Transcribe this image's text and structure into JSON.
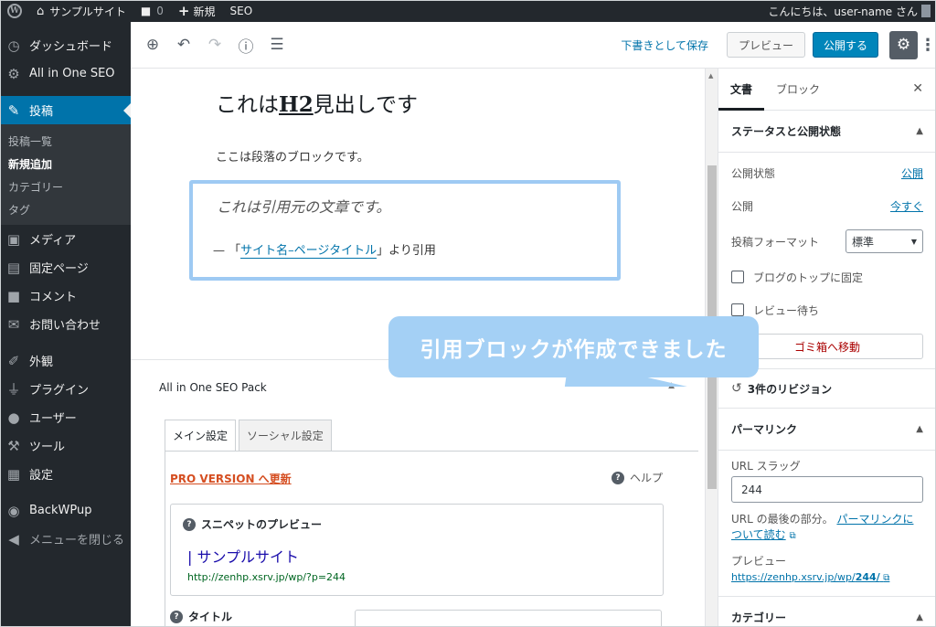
{
  "adminbar": {
    "site_name": "サンプルサイト",
    "comments_count": "0",
    "new_label": "新規",
    "seo_label": "SEO",
    "greeting": "こんにちは、user-name さん"
  },
  "sidebar": {
    "items": [
      {
        "label": "ダッシュボード",
        "icon": "dashboard-icon"
      },
      {
        "label": "All in One SEO",
        "icon": "gear-icon"
      },
      {
        "label": "投稿",
        "icon": "pin-icon"
      }
    ],
    "submenu": [
      {
        "label": "投稿一覧"
      },
      {
        "label": "新規追加"
      },
      {
        "label": "カテゴリー"
      },
      {
        "label": "タグ"
      }
    ],
    "items2": [
      {
        "label": "メディア",
        "icon": "media-icon"
      },
      {
        "label": "固定ページ",
        "icon": "page-icon"
      },
      {
        "label": "コメント",
        "icon": "comment-icon"
      },
      {
        "label": "お問い合わせ",
        "icon": "mail-icon"
      }
    ],
    "items3": [
      {
        "label": "外観",
        "icon": "brush-icon"
      },
      {
        "label": "プラグイン",
        "icon": "plugin-icon"
      },
      {
        "label": "ユーザー",
        "icon": "user-icon"
      },
      {
        "label": "ツール",
        "icon": "wrench-icon"
      },
      {
        "label": "設定",
        "icon": "settings-icon"
      }
    ],
    "items4": [
      {
        "label": "BackWPup",
        "icon": "backwpup-icon"
      },
      {
        "label": "メニューを閉じる",
        "icon": "collapse-icon"
      }
    ]
  },
  "toolbar": {
    "save_draft": "下書きとして保存",
    "preview": "プレビュー",
    "publish": "公開する"
  },
  "editor": {
    "heading_prefix": "これは",
    "heading_bold": "H2",
    "heading_suffix": "見出しです",
    "paragraph": "ここは段落のブロックです。",
    "quote_text": "これは引用元の文章です。",
    "cite_prefix": "— 「",
    "cite_link": "サイト名–ページタイトル",
    "cite_suffix": "」より引用"
  },
  "seo": {
    "box_title": "All in One SEO Pack",
    "tab_main": "メイン設定",
    "tab_social": "ソーシャル設定",
    "pro_link": "PRO VERSION へ更新",
    "help": "ヘルプ",
    "snippet_heading": "スニペットのプレビュー",
    "snippet_title": "| サンプルサイト",
    "snippet_url": "http://zenhp.xsrv.jp/wp/?p=244",
    "title_label": "タイトル"
  },
  "settings": {
    "tab_document": "文書",
    "tab_block": "ブロック",
    "status_heading": "ステータスと公開状態",
    "visibility_label": "公開状態",
    "visibility_value": "公開",
    "publish_label": "公開",
    "publish_value": "今すぐ",
    "format_label": "投稿フォーマット",
    "format_value": "標準",
    "sticky_label": "ブログのトップに固定",
    "pending_label": "レビュー待ち",
    "trash": "ゴミ箱へ移動",
    "revisions": "3件のリビジョン",
    "permalink_heading": "パーマリンク",
    "slug_label": "URL スラッグ",
    "slug_value": "244",
    "perma_desc_prefix": "URL の最後の部分。",
    "perma_desc_link": "パーマリンクについて読む",
    "preview_label": "プレビュー",
    "preview_url_prefix": "https://zenhp.xsrv.jp/wp/",
    "preview_url_bold": "244/",
    "category_heading": "カテゴリー"
  },
  "callout": {
    "text": "引用ブロックが作成できました"
  },
  "colors": {
    "admin_dark": "#23282d",
    "accent_blue": "#0073aa",
    "callout_blue": "#a4d0f5",
    "quote_border": "#9ecaf3"
  }
}
